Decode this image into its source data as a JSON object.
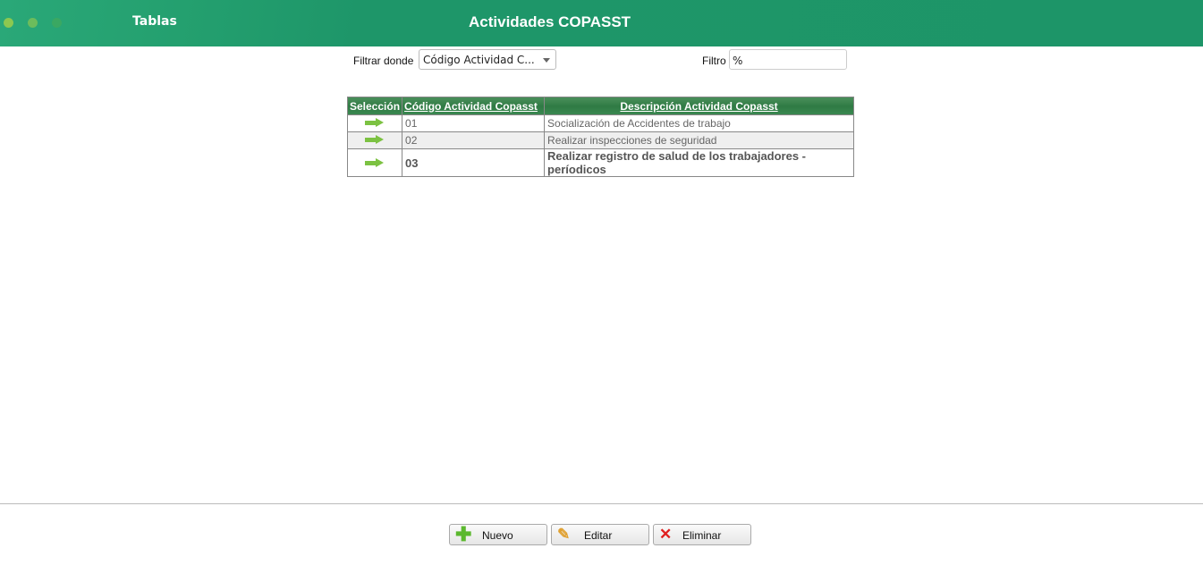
{
  "header": {
    "section": "Tablas",
    "title": "Actividades COPASST",
    "brand_color": "#1d9568"
  },
  "filter": {
    "where_label": "Filtrar donde",
    "where_value": "Código Actividad C...",
    "filter_label": "Filtro",
    "filter_value": "%"
  },
  "table": {
    "headers": [
      "Selección",
      "Código Actividad Copasst",
      "Descripción Actividad Copasst"
    ],
    "rows": [
      {
        "code": "01",
        "description": "Socialización de Accidentes de trabajo"
      },
      {
        "code": "02",
        "description": "Realizar inspecciones de seguridad"
      },
      {
        "code": "03",
        "description": "Realizar registro de salud de los trabajadores - períodicos"
      }
    ]
  },
  "buttons": {
    "new": "Nuevo",
    "edit": "Editar",
    "delete": "Eliminar"
  }
}
